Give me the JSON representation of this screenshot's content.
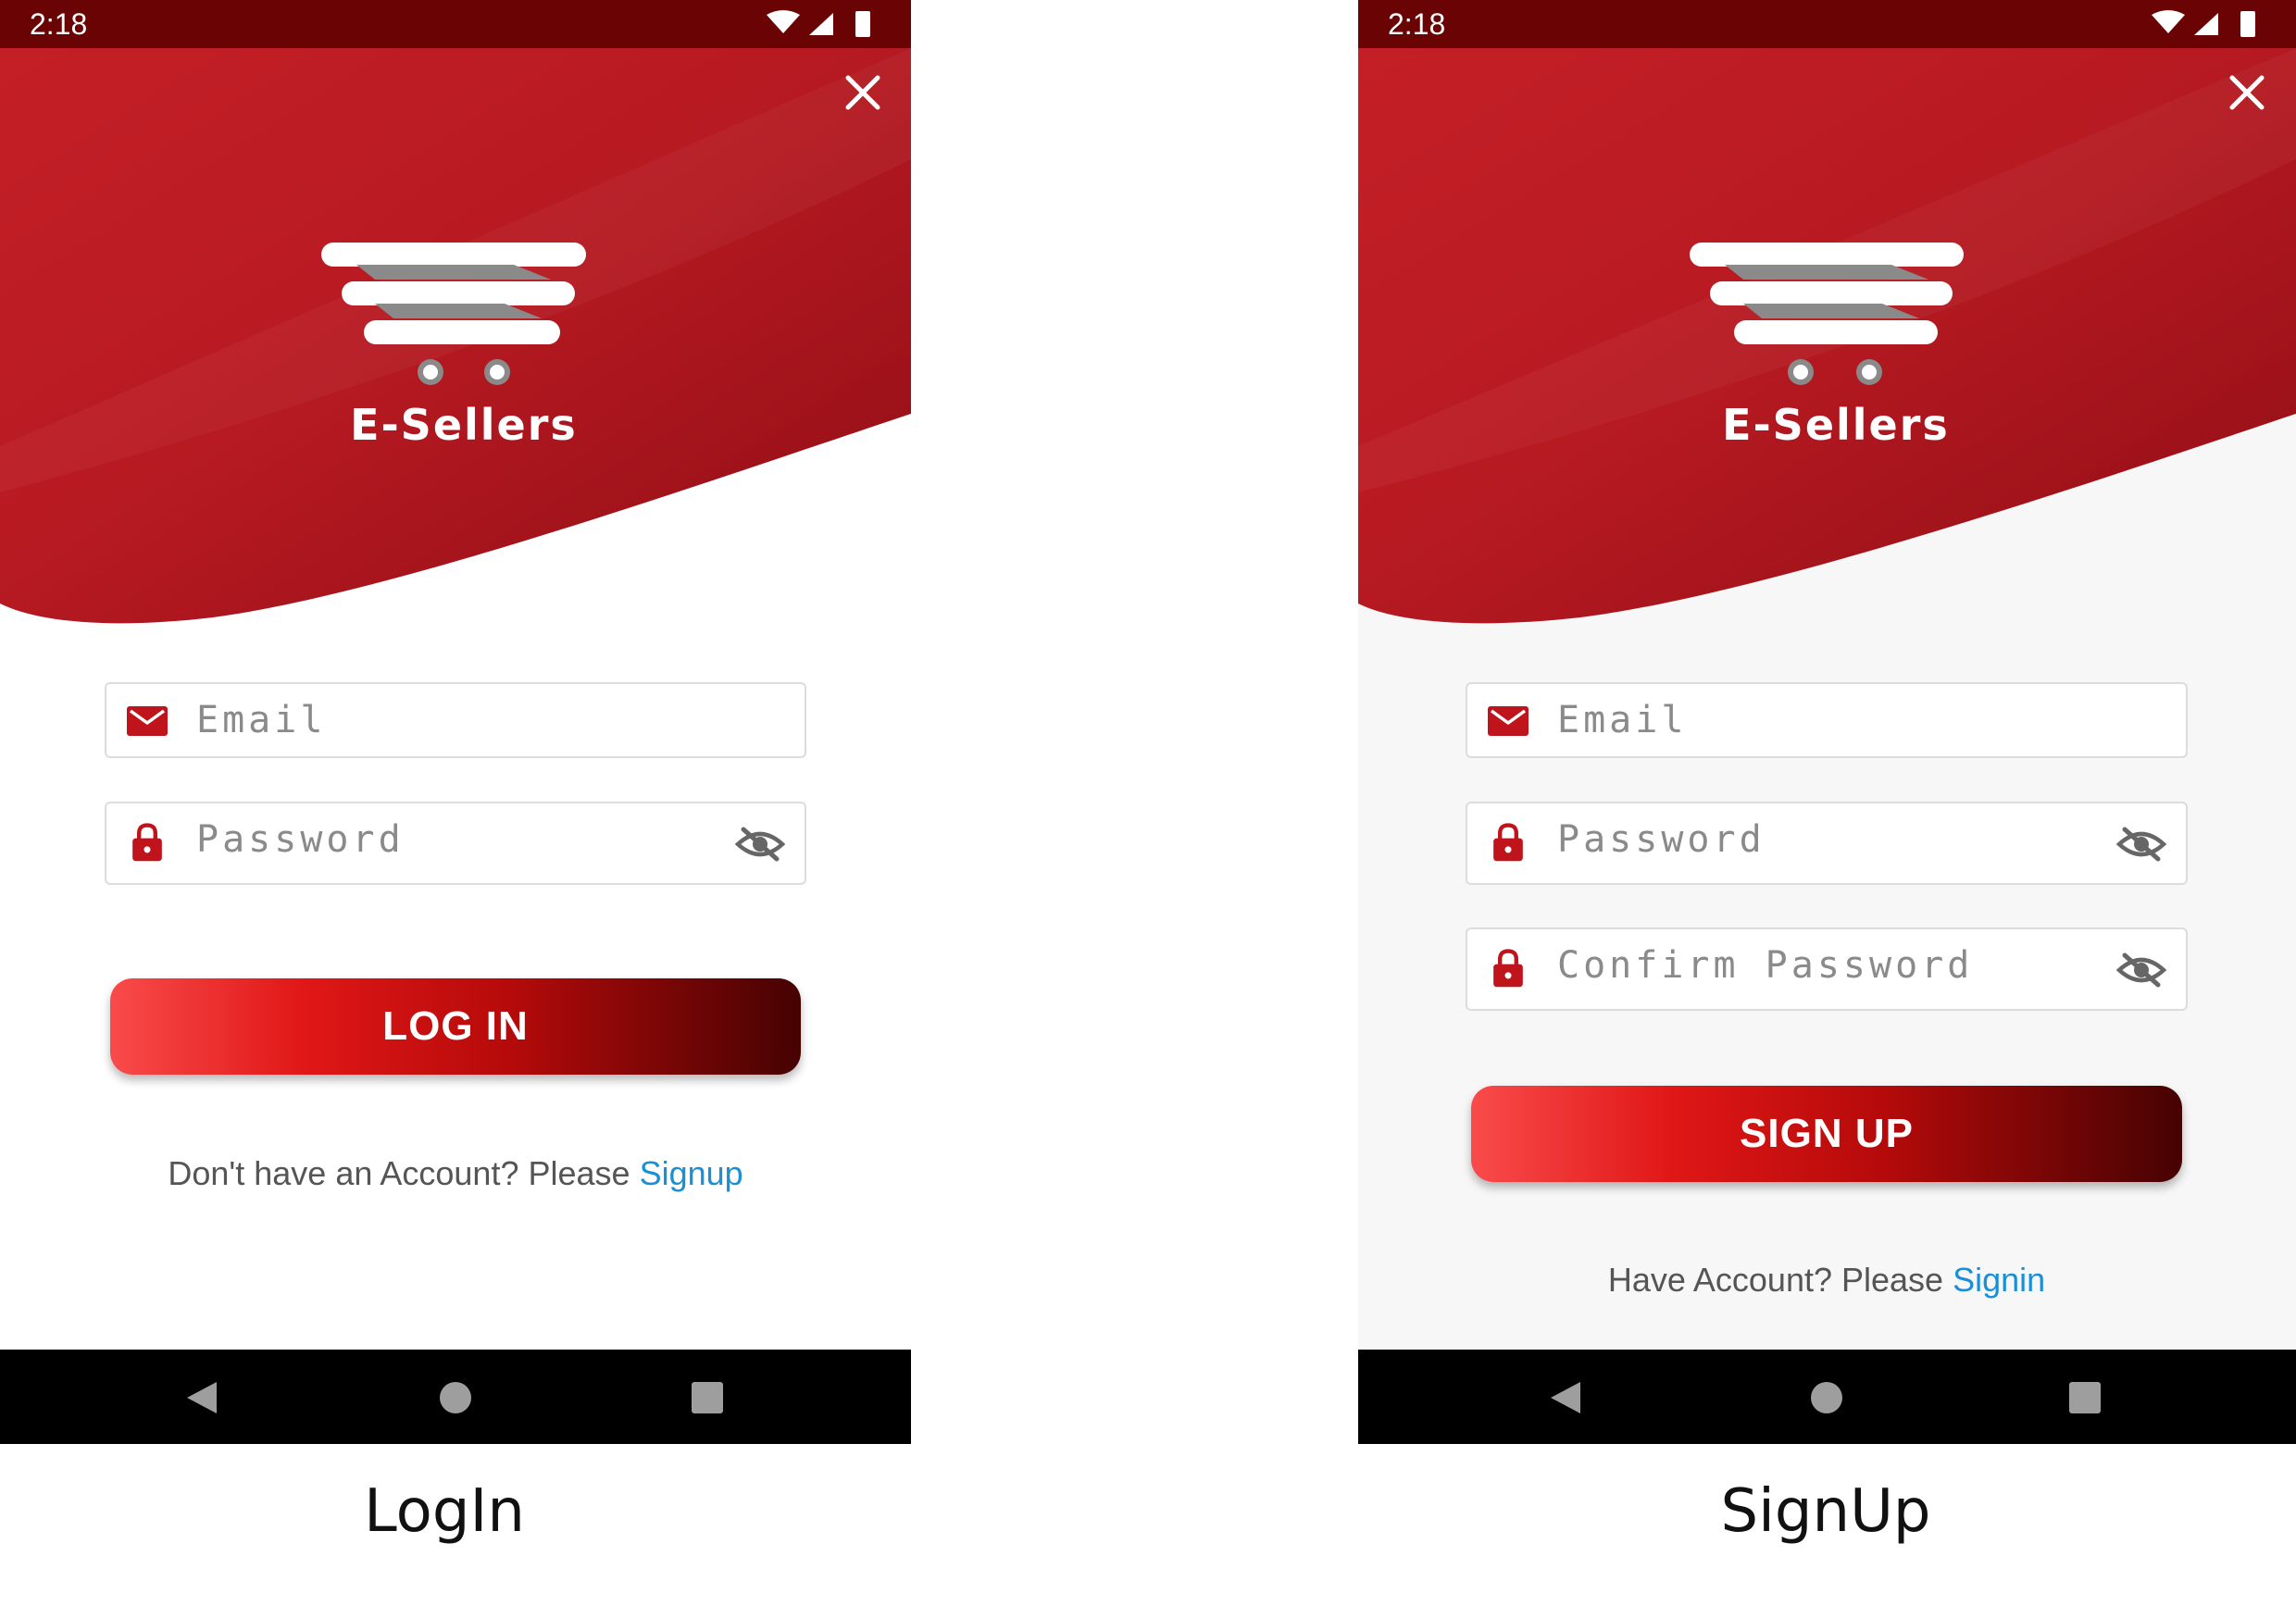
{
  "login": {
    "status_time": "2:18",
    "brand": "E-Sellers",
    "email_placeholder": "Email",
    "password_placeholder": "Password",
    "button_label": "LOG IN",
    "footer_prefix": "Don't have an Account? Please ",
    "footer_link": "Signup",
    "caption": "LogIn"
  },
  "signup": {
    "status_time": "2:18",
    "brand": "E-Sellers",
    "email_placeholder": "Email",
    "password_placeholder": "Password",
    "confirm_placeholder": "Confirm Password",
    "button_label": "SIGN UP",
    "footer_prefix": "Have Account? Please ",
    "footer_link": "Signin",
    "caption": "SignUp"
  },
  "colors": {
    "header_red": "#b81a22",
    "status_bar": "#6a0303",
    "icon_red": "#c0141c",
    "link_blue": "#1a8fd6"
  },
  "icons": [
    "close-icon",
    "logo-cart-icon",
    "mail-icon",
    "lock-icon",
    "eye-off-icon",
    "back-icon",
    "home-icon",
    "recents-icon",
    "wifi-icon",
    "signal-icon",
    "battery-icon"
  ]
}
